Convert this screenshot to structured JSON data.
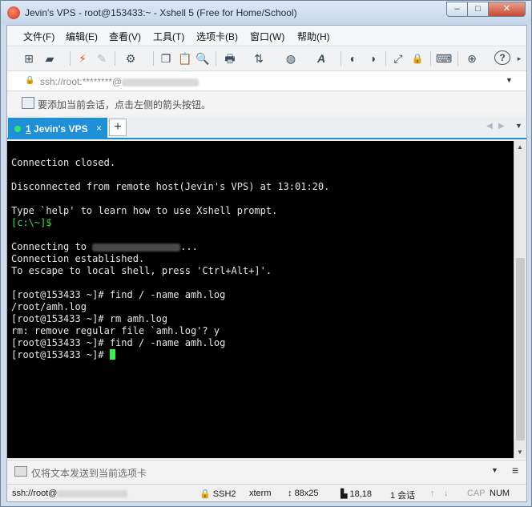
{
  "window": {
    "title": "Jevin's VPS - root@153433:~ - Xshell 5 (Free for Home/School)",
    "controls": {
      "minimize": "–",
      "maximize": "□",
      "close": "✕"
    }
  },
  "menu": [
    "文件(F)",
    "编辑(E)",
    "查看(V)",
    "工具(T)",
    "选项卡(B)",
    "窗口(W)",
    "帮助(H)"
  ],
  "toolbar": {
    "icons": [
      "new-session-icon",
      "open-icon",
      "reconnect-icon",
      "disconnect-icon",
      "properties-icon",
      "copy-icon",
      "paste-icon",
      "find-icon",
      "print-icon",
      "transfer-icon",
      "globe-icon",
      "font-icon",
      "xftp-icon",
      "xagent-icon",
      "fullscreen-icon",
      "lock-icon",
      "keyboard-icon",
      "new-tab-icon",
      "help-icon"
    ],
    "glyphs": {
      "new": "⊞",
      "open": "▰",
      "reconnect": "⚡",
      "disconnect": "✎",
      "props": "⚙",
      "copy": "❐",
      "paste": "📋",
      "find": "🔍",
      "print": "🖶",
      "transfer": "⇅",
      "globe": "◍",
      "font": "A",
      "xftp": "◐",
      "xagent": "◑",
      "fullscreen": "⤢",
      "lock": "🔒",
      "keyboard": "⌨",
      "newtab": "⊕",
      "help": "?",
      "more": "▸"
    }
  },
  "address": {
    "text": "ssh://root:********@",
    "lock": "🔒",
    "dropdown": "▼"
  },
  "hint": {
    "text": "要添加当前会话，点击左侧的箭头按钮。"
  },
  "tabs": [
    {
      "number": "1",
      "label": " Jevin's VPS",
      "close": "×",
      "status_color": "#2ee86a"
    }
  ],
  "tab_add": "+",
  "tab_nav": {
    "left": "◀",
    "right": "▶",
    "menu": "▼"
  },
  "terminal": {
    "lines": [
      {
        "text": "Connection closed.",
        "color": "normal"
      },
      {
        "text": "",
        "color": "normal"
      },
      {
        "text": "Disconnected from remote host(Jevin's VPS) at 13:01:20.",
        "color": "normal"
      },
      {
        "text": "",
        "color": "normal"
      },
      {
        "text": "Type `help' to learn how to use Xshell prompt.",
        "color": "normal"
      },
      {
        "text": "[c:\\~]$",
        "color": "green"
      },
      {
        "text": "",
        "color": "normal"
      },
      {
        "text": "Connecting to ",
        "color": "normal",
        "suffix": "...",
        "redacted": true
      },
      {
        "text": "Connection established.",
        "color": "normal"
      },
      {
        "text": "To escape to local shell, press 'Ctrl+Alt+]'.",
        "color": "normal"
      },
      {
        "text": "",
        "color": "normal"
      },
      {
        "text": "[root@153433 ~]# find / -name amh.log",
        "color": "normal"
      },
      {
        "text": "/root/amh.log",
        "color": "normal"
      },
      {
        "text": "[root@153433 ~]# rm amh.log",
        "color": "normal"
      },
      {
        "text": "rm: remove regular file `amh.log'? y",
        "color": "normal"
      },
      {
        "text": "[root@153433 ~]# find / -name amh.log",
        "color": "normal"
      },
      {
        "text": "[root@153433 ~]# ",
        "color": "normal",
        "cursor": true
      }
    ]
  },
  "sendbar": {
    "text": "仅将文本发送到当前选项卡",
    "dropdown": "▼",
    "menu": "≡"
  },
  "status": {
    "host": "ssh://root@",
    "protocol": "SSH2",
    "terminal": "xterm",
    "size": "88x25",
    "position": "18,18",
    "sessions": "1 会话",
    "up": "↑",
    "down": "↓",
    "cap": "CAP",
    "num": "NUM"
  },
  "colors": {
    "accent": "#1e90d8",
    "terminal_bg": "#000000",
    "prompt_green": "#36e24a",
    "cursor": "#35f04a"
  }
}
